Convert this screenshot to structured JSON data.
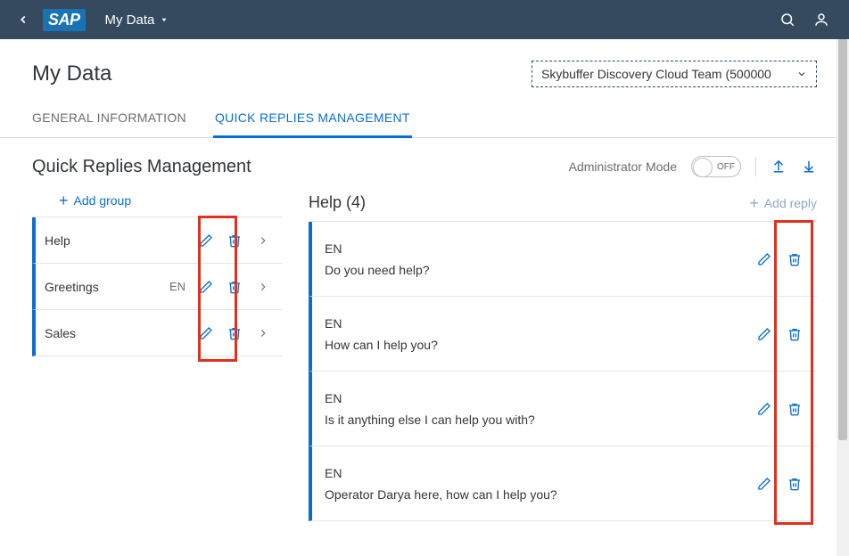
{
  "shell": {
    "app_title": "My Data"
  },
  "page": {
    "title": "My Data",
    "team_selected": "Skybuffer Discovery Cloud Team (500000"
  },
  "tabs": {
    "general": "GENERAL INFORMATION",
    "quick": "QUICK REPLIES MANAGEMENT"
  },
  "section": {
    "title": "Quick Replies Management",
    "admin_label": "Administrator Mode",
    "toggle_value": "OFF"
  },
  "left": {
    "add_group": "Add group",
    "groups": [
      {
        "name": "Help",
        "lang": ""
      },
      {
        "name": "Greetings",
        "lang": "EN"
      },
      {
        "name": "Sales",
        "lang": ""
      }
    ]
  },
  "right": {
    "title": "Help (4)",
    "add_reply": "Add reply",
    "replies": [
      {
        "lang": "EN",
        "text": "Do you need help?"
      },
      {
        "lang": "EN",
        "text": "How can I help you?"
      },
      {
        "lang": "EN",
        "text": "Is it anything else I can help you with?"
      },
      {
        "lang": "EN",
        "text": "Operator Darya here, how can I help you?"
      }
    ]
  }
}
